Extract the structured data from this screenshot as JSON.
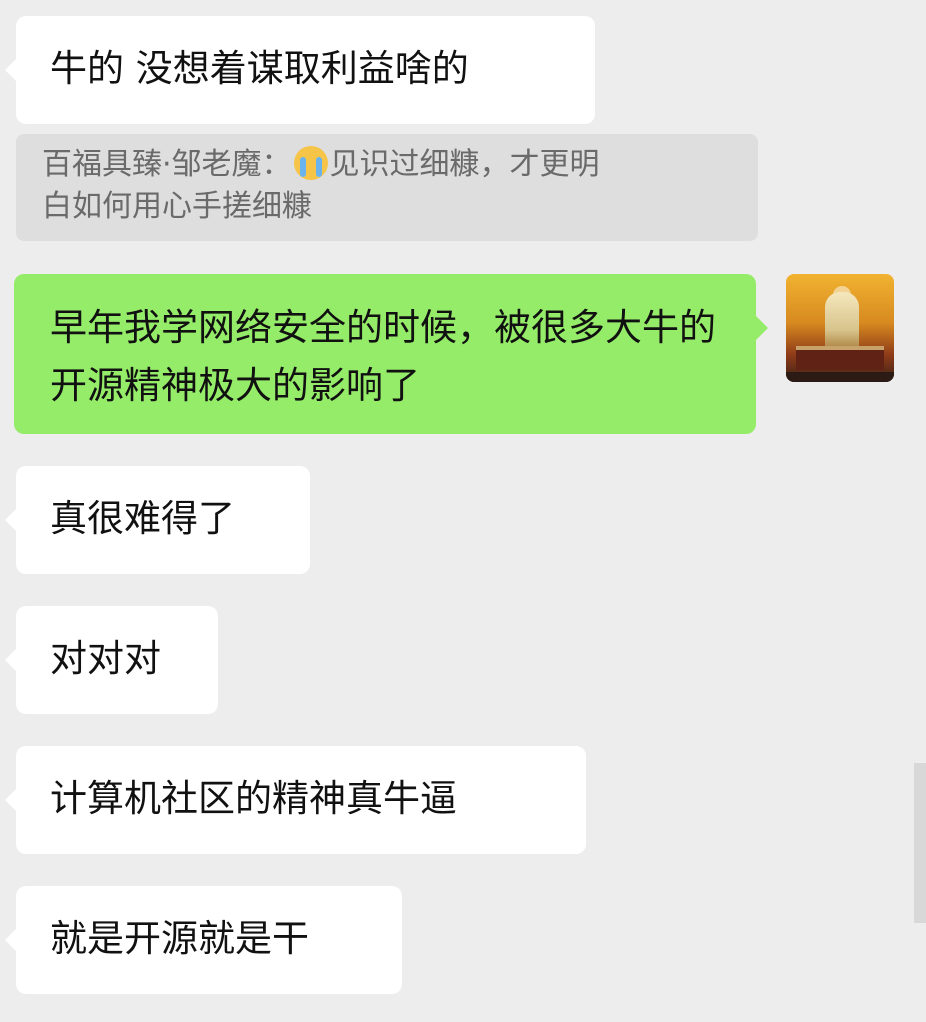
{
  "chat": {
    "messages": [
      {
        "side": "left",
        "text": "牛的 没想着谋取利益啥的"
      },
      {
        "quote_author": "百福具臻·邹老魔：",
        "quote_emoji": "crying-emoji",
        "quote_line1": "见识过细糠，才更明",
        "quote_line2": "白如何用心手搓细糠"
      },
      {
        "side": "right",
        "text": "早年我学网络安全的时候，被很多大牛的开源精神极大的影响了"
      },
      {
        "side": "left",
        "text": "真很难得了"
      },
      {
        "side": "left",
        "text": "对对对"
      },
      {
        "side": "left",
        "text": "计算机社区的精神真牛逼"
      },
      {
        "side": "left",
        "text": "就是开源就是干"
      }
    ]
  },
  "colors": {
    "background": "#ededed",
    "left_bubble": "#ffffff",
    "right_bubble": "#95ec69",
    "quote_bg": "#dedede",
    "quote_text": "#6a6a6a"
  },
  "icons": {
    "avatar": "temple-statue-avatar",
    "emoji": "crying-emoji"
  }
}
